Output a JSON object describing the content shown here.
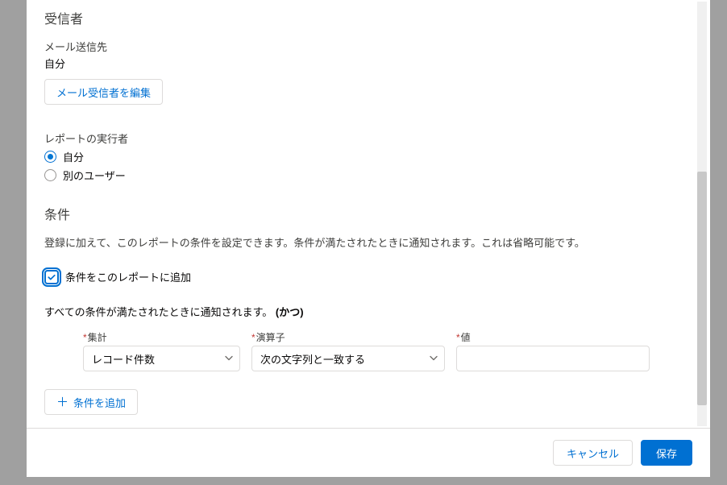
{
  "recipients": {
    "title": "受信者",
    "send_to_label": "メール送信先",
    "send_to_value": "自分",
    "edit_button": "メール受信者を編集"
  },
  "run_as": {
    "title": "レポートの実行者",
    "options": {
      "self": "自分",
      "other": "別のユーザー"
    },
    "selected": "self"
  },
  "conditions": {
    "title": "条件",
    "help": "登録に加えて、このレポートの条件を設定できます。条件が満たされたときに通知されます。これは省略可能です。",
    "add_checkbox_label": "条件をこのレポートに追加",
    "checked": true,
    "notify_text_prefix": "すべての条件が満たされたときに通知されます。",
    "notify_text_logic": "(かつ)",
    "labels": {
      "aggregate": "集計",
      "operator": "演算子",
      "value": "値"
    },
    "row": {
      "aggregate": "レコード件数",
      "operator": "次の文字列と一致する",
      "value": ""
    },
    "add_condition_button": "条件を追加"
  },
  "footer": {
    "cancel": "キャンセル",
    "save": "保存"
  },
  "icons": {
    "plus": "＋"
  }
}
